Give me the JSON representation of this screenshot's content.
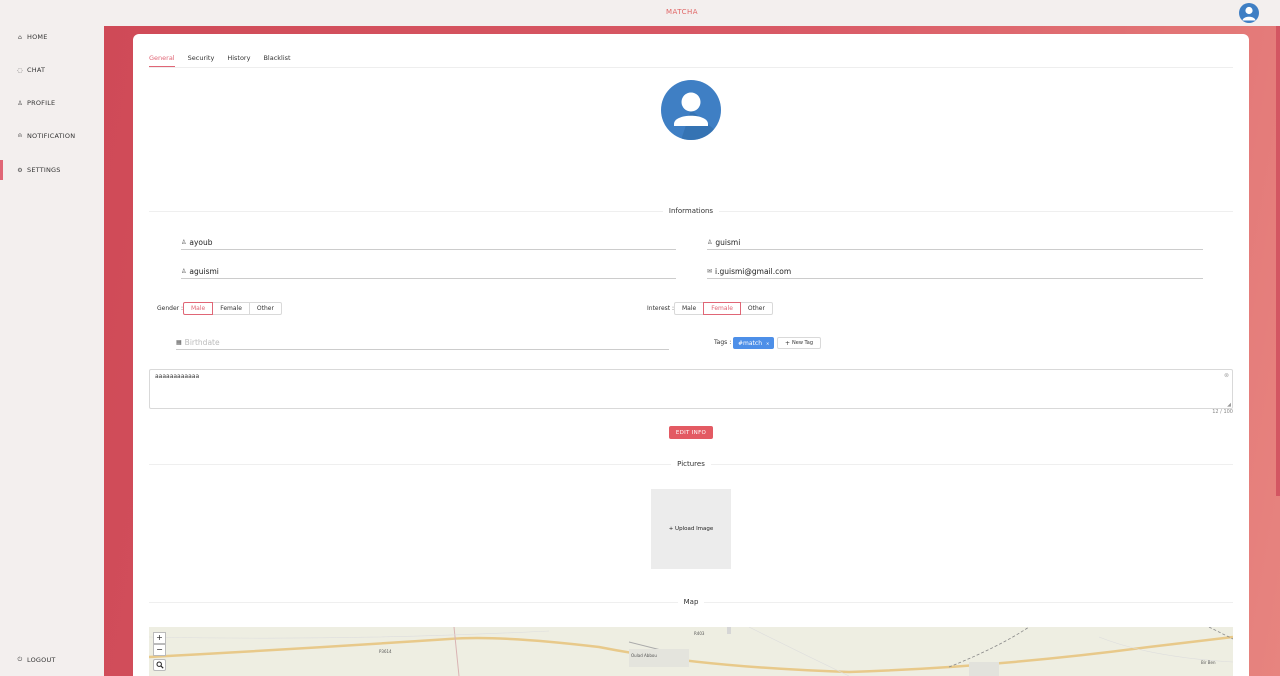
{
  "app": {
    "title": "MATCHA"
  },
  "sidebar": {
    "items": [
      {
        "label": "HOME",
        "icon": "home-icon",
        "glyph": "⌂"
      },
      {
        "label": "CHAT",
        "icon": "chat-icon",
        "glyph": "◌"
      },
      {
        "label": "PROFILE",
        "icon": "user-icon",
        "glyph": "♙"
      },
      {
        "label": "NOTIFICATION",
        "icon": "bell-icon",
        "glyph": "⍝"
      },
      {
        "label": "SETTINGS",
        "icon": "gear-icon",
        "glyph": "⚙"
      }
    ],
    "active": "SETTINGS",
    "logout": {
      "label": "LOGOUT",
      "icon": "logout-icon",
      "glyph": "⏻"
    }
  },
  "tabs": [
    "General",
    "Security",
    "History",
    "Blacklist"
  ],
  "active_tab": "General",
  "sections": {
    "informations": "Informations",
    "pictures": "Pictures",
    "map": "Map"
  },
  "form": {
    "first_name": "ayoub",
    "last_name": "guismi",
    "username": "aguismi",
    "email": "i.guismi@gmail.com",
    "birthdate_placeholder": "Birthdate",
    "gender": {
      "label": "Gender :",
      "options": [
        "Male",
        "Female",
        "Other"
      ],
      "selected": "Male"
    },
    "interest": {
      "label": "Interest :",
      "options": [
        "Male",
        "Female",
        "Other"
      ],
      "selected": "Female"
    },
    "tags": {
      "label": "Tags :",
      "items": [
        "#match"
      ],
      "new_tag_label": "New Tag"
    },
    "bio": "aaaaaaaaaaaa",
    "bio_counter": "12 / 100",
    "edit_button": "EDIT INFO"
  },
  "pictures": {
    "upload_label": "+ Upload Image"
  },
  "map": {
    "zoom_in": "+",
    "zoom_out": "−",
    "labels": [
      "Oulad Abbou",
      "R403",
      "P3614",
      "Bir Ben"
    ]
  },
  "colors": {
    "accent": "#e06676",
    "primary_button": "#e35a63",
    "tag_blue": "#4d8fe8",
    "avatar_blue": "#3f7fc4"
  }
}
